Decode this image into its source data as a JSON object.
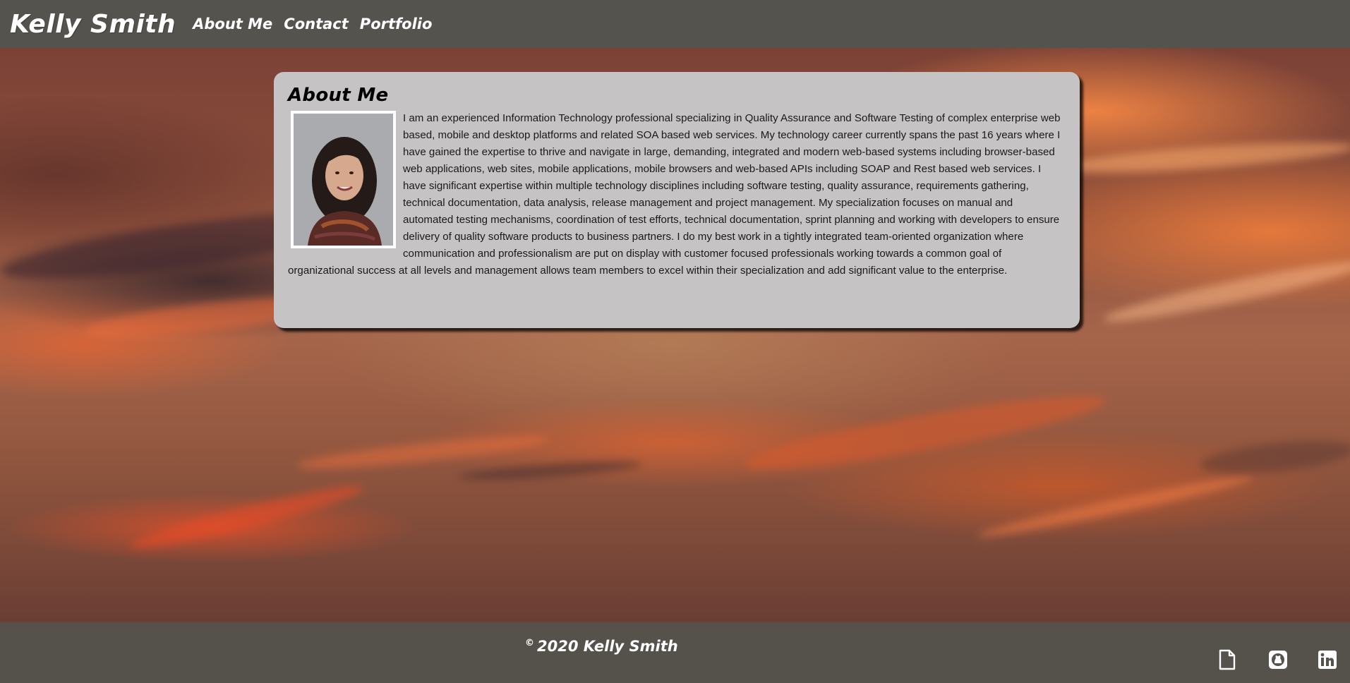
{
  "header": {
    "brand": "Kelly Smith",
    "nav": [
      {
        "label": "About Me"
      },
      {
        "label": "Contact"
      },
      {
        "label": "Portfolio"
      }
    ]
  },
  "about": {
    "title": "About Me",
    "bio": "I am an experienced Information Technology professional specializing in Quality Assurance and Software Testing of complex enterprise web based, mobile and desktop platforms and related SOA based web services. My technology career currently spans the past 16 years where I have gained the expertise to thrive and navigate in large, demanding, integrated and modern web-based systems including browser-based web applications, web sites, mobile applications, mobile browsers and web-based APIs including SOAP and Rest based web services. I have significant expertise within multiple technology disciplines including software testing, quality assurance, requirements gathering, technical documentation, data analysis, release management and project management. My specialization focuses on manual and automated testing mechanisms, coordination of test efforts, technical documentation, sprint planning and working with developers to ensure delivery of quality software products to business partners. I do my best work in a tightly integrated team-oriented organization where communication and professionalism are put on display with customer focused professionals working towards a common goal of organizational success at all levels and management allows team members to excel within their specialization and add significant value to the enterprise."
  },
  "footer": {
    "copyright_symbol": "©",
    "copyright_text": "2020 Kelly Smith",
    "social_icons": [
      "resume-document-icon",
      "github-icon",
      "linkedin-icon"
    ]
  },
  "colors": {
    "header_bg": "#55534d",
    "card_bg": "#c5c3c4",
    "text_white": "#ffffff"
  }
}
